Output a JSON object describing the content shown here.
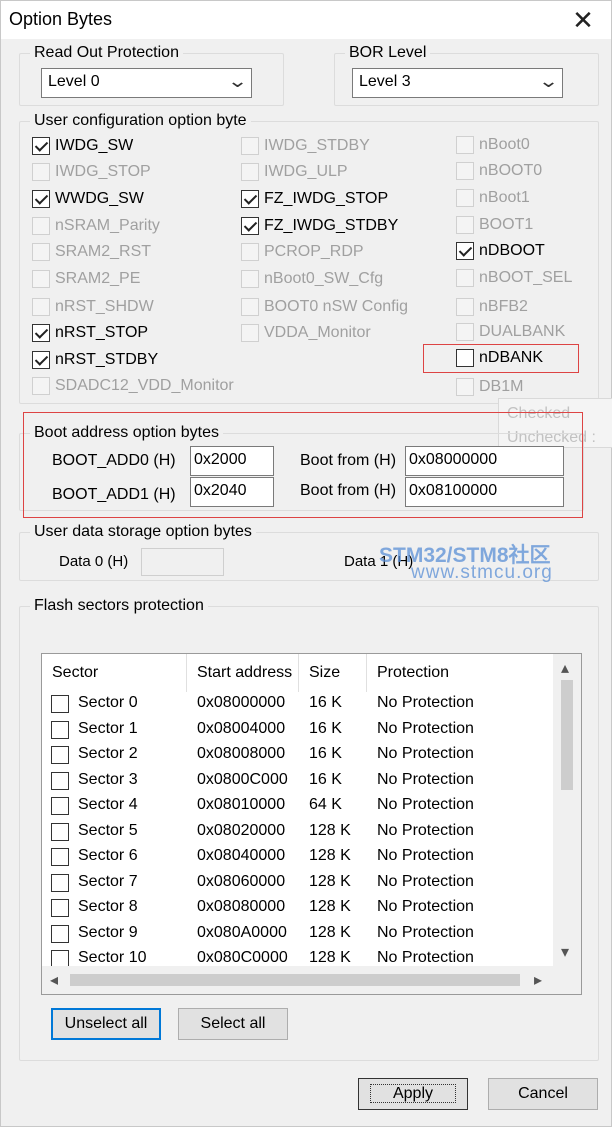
{
  "window": {
    "title": "Option Bytes"
  },
  "rdp": {
    "title": "Read Out Protection",
    "value": "Level 0"
  },
  "bor": {
    "title": "BOR Level",
    "value": "Level 3"
  },
  "user_config": {
    "title": "User configuration option byte",
    "col1": [
      {
        "label": "IWDG_SW",
        "checked": true,
        "enabled": true
      },
      {
        "label": "IWDG_STOP",
        "checked": false,
        "enabled": false
      },
      {
        "label": "WWDG_SW",
        "checked": true,
        "enabled": true
      },
      {
        "label": "nSRAM_Parity",
        "checked": false,
        "enabled": false
      },
      {
        "label": "SRAM2_RST",
        "checked": false,
        "enabled": false
      },
      {
        "label": "SRAM2_PE",
        "checked": false,
        "enabled": false
      },
      {
        "label": "nRST_SHDW",
        "checked": false,
        "enabled": false
      },
      {
        "label": "nRST_STOP",
        "checked": true,
        "enabled": true
      },
      {
        "label": "nRST_STDBY",
        "checked": true,
        "enabled": true
      },
      {
        "label": "SDADC12_VDD_Monitor",
        "checked": false,
        "enabled": false
      }
    ],
    "col2": [
      {
        "label": "IWDG_STDBY",
        "checked": false,
        "enabled": false
      },
      {
        "label": "IWDG_ULP",
        "checked": false,
        "enabled": false
      },
      {
        "label": "FZ_IWDG_STOP",
        "checked": true,
        "enabled": true
      },
      {
        "label": "FZ_IWDG_STDBY",
        "checked": true,
        "enabled": true
      },
      {
        "label": "PCROP_RDP",
        "checked": false,
        "enabled": false
      },
      {
        "label": "nBoot0_SW_Cfg",
        "checked": false,
        "enabled": false
      },
      {
        "label": "BOOT0 nSW Config",
        "checked": false,
        "enabled": false
      },
      {
        "label": "VDDA_Monitor",
        "checked": false,
        "enabled": false
      }
    ],
    "col3": [
      {
        "label": "nBoot0",
        "checked": false,
        "enabled": false
      },
      {
        "label": "nBOOT0",
        "checked": false,
        "enabled": false
      },
      {
        "label": "nBoot1",
        "checked": false,
        "enabled": false
      },
      {
        "label": "BOOT1",
        "checked": false,
        "enabled": false
      },
      {
        "label": "nDBOOT",
        "checked": true,
        "enabled": true
      },
      {
        "label": "nBOOT_SEL",
        "checked": false,
        "enabled": false
      },
      {
        "label": "nBFB2",
        "checked": false,
        "enabled": false
      },
      {
        "label": "DUALBANK",
        "checked": false,
        "enabled": false
      },
      {
        "label": "nDBANK",
        "checked": false,
        "enabled": true
      },
      {
        "label": "DB1M",
        "checked": false,
        "enabled": false
      }
    ]
  },
  "tooltip": {
    "line1": "Checked",
    "line2": "Unchecked :"
  },
  "boot_address": {
    "title": "Boot address option bytes",
    "add0_label": "BOOT_ADD0 (H)",
    "add0_value": "0x2000",
    "add1_label": "BOOT_ADD1 (H)",
    "add1_value": "0x2040",
    "boot_from_label_0": "Boot from (H)",
    "boot_from_value_0": "0x08000000",
    "boot_from_label_1": "Boot from (H)",
    "boot_from_value_1": "0x08100000"
  },
  "user_data": {
    "title": "User data storage option bytes",
    "data0_label": "Data 0 (H)",
    "data0_value": "",
    "data1_label": "Data 1 (H)"
  },
  "watermark": {
    "line1": "STM32/STM8社区",
    "line2": "www.stmcu.org"
  },
  "flash": {
    "title": "Flash sectors protection",
    "columns": [
      "Sector",
      "Start address",
      "Size",
      "Protection"
    ],
    "rows": [
      {
        "sector": "Sector 0",
        "address": "0x08000000",
        "size": "16 K",
        "protection": "No Protection"
      },
      {
        "sector": "Sector 1",
        "address": "0x08004000",
        "size": "16 K",
        "protection": "No Protection"
      },
      {
        "sector": "Sector 2",
        "address": "0x08008000",
        "size": "16 K",
        "protection": "No Protection"
      },
      {
        "sector": "Sector 3",
        "address": "0x0800C000",
        "size": "16 K",
        "protection": "No Protection"
      },
      {
        "sector": "Sector 4",
        "address": "0x08010000",
        "size": "64 K",
        "protection": "No Protection"
      },
      {
        "sector": "Sector 5",
        "address": "0x08020000",
        "size": "128 K",
        "protection": "No Protection"
      },
      {
        "sector": "Sector 6",
        "address": "0x08040000",
        "size": "128 K",
        "protection": "No Protection"
      },
      {
        "sector": "Sector 7",
        "address": "0x08060000",
        "size": "128 K",
        "protection": "No Protection"
      },
      {
        "sector": "Sector 8",
        "address": "0x08080000",
        "size": "128 K",
        "protection": "No Protection"
      },
      {
        "sector": "Sector 9",
        "address": "0x080A0000",
        "size": "128 K",
        "protection": "No Protection"
      },
      {
        "sector": "Sector 10",
        "address": "0x080C0000",
        "size": "128 K",
        "protection": "No Protection"
      }
    ],
    "unselect_all": "Unselect all",
    "select_all": "Select all"
  },
  "buttons": {
    "apply": "Apply",
    "cancel": "Cancel"
  }
}
